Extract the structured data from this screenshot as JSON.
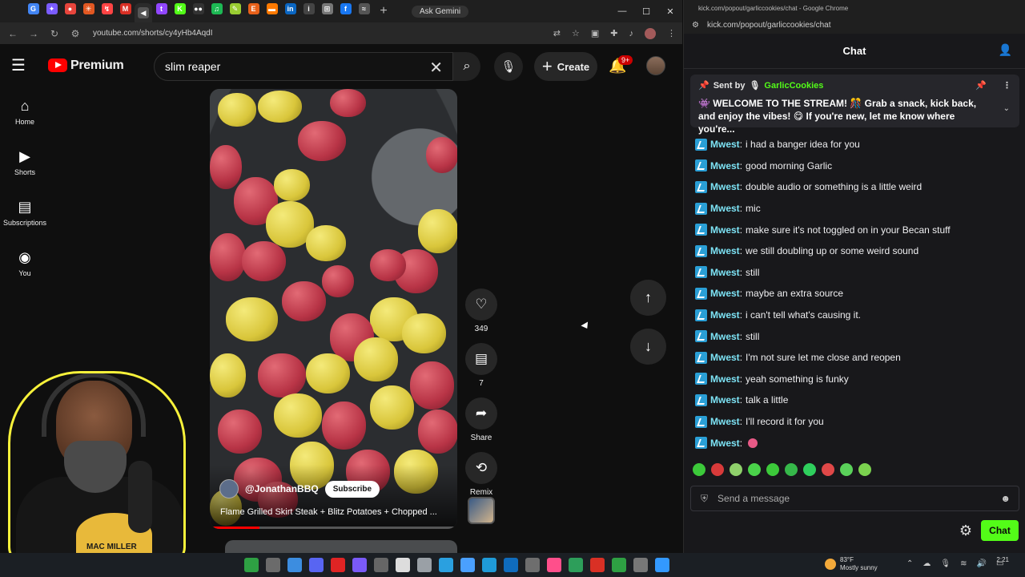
{
  "browser_left": {
    "ask_gemini": "Ask Gemini",
    "url": "youtube.com/shorts/cy4yHb4AqdI",
    "tab_favicons": [
      {
        "color": "#4285f4",
        "glyph": "G"
      },
      {
        "color": "#7b5cff",
        "glyph": "✦"
      },
      {
        "color": "#e8453c",
        "glyph": "●"
      },
      {
        "color": "#e25822",
        "glyph": "✳"
      },
      {
        "color": "#ff4444",
        "glyph": "↯"
      },
      {
        "color": "#d93025",
        "glyph": "M"
      },
      {
        "color": "#555555",
        "glyph": "◀"
      },
      {
        "color": "#9146ff",
        "glyph": "t"
      },
      {
        "color": "#53fc18",
        "glyph": "K"
      },
      {
        "color": "#333333",
        "glyph": "●●"
      },
      {
        "color": "#1db954",
        "glyph": "♫"
      },
      {
        "color": "#9acd32",
        "glyph": "✎"
      },
      {
        "color": "#e8611a",
        "glyph": "E"
      },
      {
        "color": "#ff7a00",
        "glyph": "▬"
      },
      {
        "color": "#0a66c2",
        "glyph": "in"
      },
      {
        "color": "#444444",
        "glyph": "i"
      },
      {
        "color": "#777777",
        "glyph": "⊞"
      },
      {
        "color": "#1877f2",
        "glyph": "f"
      },
      {
        "color": "#555555",
        "glyph": "≈"
      }
    ]
  },
  "youtube": {
    "logo_text": "Premium",
    "search_value": "slim reaper",
    "create_label": "Create",
    "notification_count": "9+",
    "nav": [
      {
        "icon": "home-icon",
        "glyph": "⌂",
        "label": "Home"
      },
      {
        "icon": "shorts-icon",
        "glyph": "▶",
        "label": "Shorts"
      },
      {
        "icon": "subscriptions-icon",
        "glyph": "▤",
        "label": "Subscriptions"
      },
      {
        "icon": "you-icon",
        "glyph": "◉",
        "label": "You"
      }
    ],
    "short": {
      "channel": "@JonathanBBQ",
      "subscribe_label": "Subscribe",
      "title": "Flame Grilled Skirt Steak + Blitz Potatoes + Chopped ...",
      "progress": 0.2
    },
    "actions": {
      "like_count": "349",
      "comment_count": "7",
      "share_label": "Share",
      "remix_label": "Remix"
    }
  },
  "webcam": {
    "shirt_text": "MAC MILLER"
  },
  "chat_window": {
    "window_title": "kick.com/popout/garliccookies/chat - Google Chrome",
    "url": "kick.com/popout/garliccookies/chat",
    "header": "Chat",
    "pinned": {
      "sent_by_label": "Sent by",
      "sender": "GarlicCookies",
      "message": "👾 WELCOME TO THE STREAM! 🎊 Grab a snack, kick back, and enjoy the vibes! 😋 If you're new, let me know where you're..."
    },
    "messages": [
      {
        "user": "Mwest",
        "text": "i had a banger idea for you"
      },
      {
        "user": "Mwest",
        "text": "good morning Garlic"
      },
      {
        "user": "Mwest",
        "text": "double audio or something is a little weird"
      },
      {
        "user": "Mwest",
        "text": "mic"
      },
      {
        "user": "Mwest",
        "text": "make sure it's not toggled on in your Becan stuff"
      },
      {
        "user": "Mwest",
        "text": "we still doubling up or some weird sound"
      },
      {
        "user": "Mwest",
        "text": "still"
      },
      {
        "user": "Mwest",
        "text": "maybe an extra source"
      },
      {
        "user": "Mwest",
        "text": "i can't tell what's causing it."
      },
      {
        "user": "Mwest",
        "text": "still"
      },
      {
        "user": "Mwest",
        "text": "I'm not sure let me close and reopen"
      },
      {
        "user": "Mwest",
        "text": "yeah something is funky"
      },
      {
        "user": "Mwest",
        "text": "talk a little"
      },
      {
        "user": "Mwest",
        "text": "I'll record it for you"
      },
      {
        "user": "Mwest",
        "text": ""
      }
    ],
    "emote_colors": [
      "#3cc93a",
      "#d83a3a",
      "#8fd06b",
      "#4ad24a",
      "#3cc93a",
      "#36b84a",
      "#2fcf5d",
      "#e04848",
      "#5ad15a",
      "#7bd24f"
    ],
    "input_placeholder": "Send a message",
    "chat_button": "Chat"
  },
  "taskbar": {
    "icon_colors": [
      "#2ea043",
      "#6b6b6b",
      "#3c8de0",
      "#5865f2",
      "#e02424",
      "#7a5af8",
      "#666666",
      "#dddddd",
      "#9aa0a6",
      "#2aa0e0",
      "#4aa0ff",
      "#1f9bd8",
      "#0f6cbd",
      "#6e6e6e",
      "#ff4f8b",
      "#2d9e5a",
      "#d93025",
      "#2ea043",
      "#777777",
      "#3399ff"
    ],
    "weather_temp": "83°F",
    "weather_desc": "Mostly sunny",
    "clock": "2:21"
  }
}
